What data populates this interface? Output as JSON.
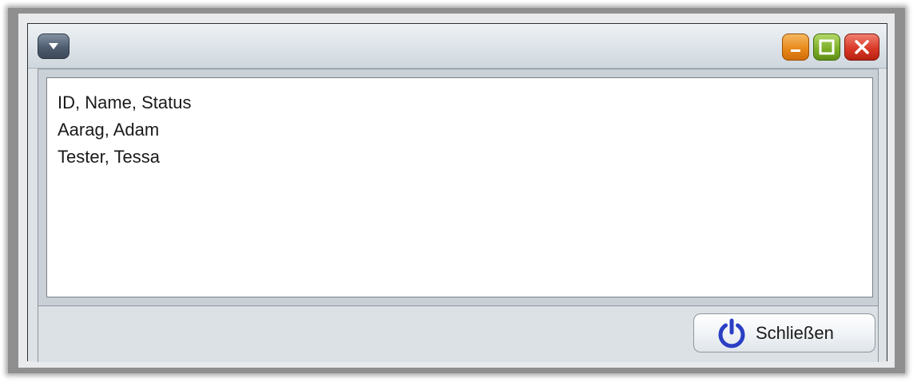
{
  "window": {
    "menu_icon": "chevron-down-icon",
    "controls": {
      "minimize_icon": "minimize-icon",
      "maximize_icon": "maximize-icon",
      "close_icon": "close-icon",
      "minimize_color": "#e88a1c",
      "maximize_color": "#7fb02a",
      "close_color": "#d93a28"
    }
  },
  "text_area": {
    "lines": [
      "ID, Name, Status",
      "Aarag, Adam",
      "Tester, Tessa"
    ]
  },
  "footer": {
    "close_button_label": "Schließen",
    "close_button_icon": "power-icon",
    "power_icon_color": "#2b3fc4"
  }
}
